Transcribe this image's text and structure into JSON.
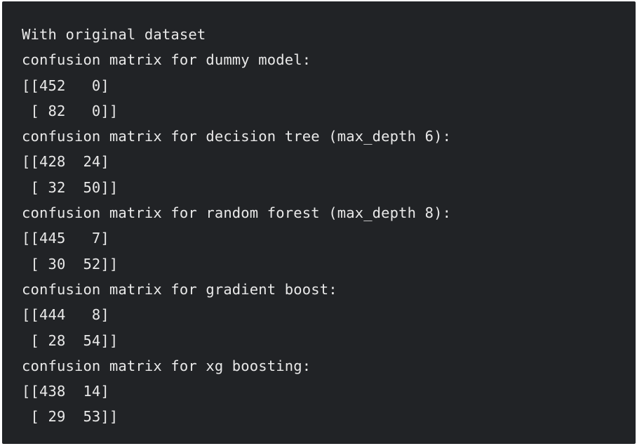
{
  "output": {
    "lines": [
      "With original dataset",
      "confusion matrix for dummy model:",
      "[[452   0]",
      " [ 82   0]]",
      "confusion matrix for decision tree (max_depth 6):",
      "[[428  24]",
      " [ 32  50]]",
      "confusion matrix for random forest (max_depth 8):",
      "[[445   7]",
      " [ 30  52]]",
      "confusion matrix for gradient boost:",
      "[[444   8]",
      " [ 28  54]]",
      "confusion matrix for xg boosting:",
      "[[438  14]",
      " [ 29  53]]"
    ]
  },
  "colors": {
    "panel_background": "#212326",
    "text": "#e9e9e9",
    "page_background": "#ffffff"
  }
}
